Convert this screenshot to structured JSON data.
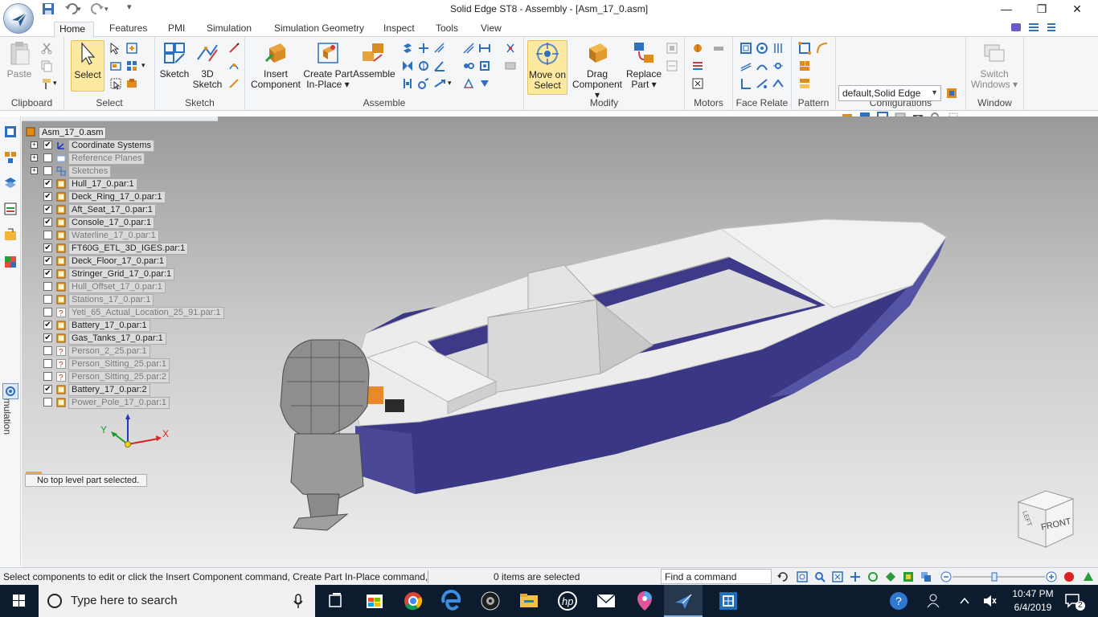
{
  "window": {
    "title": "Solid Edge ST8 - Assembly - [Asm_17_0.asm]",
    "minimize_glyph": "—",
    "maximize_glyph": "❐",
    "close_glyph": "✕"
  },
  "quick_access": {
    "save_icon": "save-icon",
    "undo_icon": "undo-icon",
    "redo_icon": "redo-icon",
    "customize_glyph": "▾"
  },
  "ribbon_tabs": [
    "Home",
    "Features",
    "PMI",
    "Simulation",
    "Simulation Geometry",
    "Inspect",
    "Tools",
    "View"
  ],
  "ribbon": {
    "clipboard": {
      "label": "Clipboard",
      "paste": "Paste"
    },
    "select": {
      "label": "Select",
      "select": "Select"
    },
    "sketch": {
      "label": "Sketch",
      "sketch": "Sketch",
      "sketch3d_line1": "3D",
      "sketch3d_line2": "Sketch"
    },
    "assemble": {
      "label": "Assemble",
      "insert_line1": "Insert",
      "insert_line2": "Component",
      "create_line1": "Create Part",
      "create_line2": "In-Place ▾",
      "assemble": "Assemble"
    },
    "modify": {
      "label": "Modify",
      "move_line1": "Move on",
      "move_line2": "Select",
      "drag_line1": "Drag",
      "drag_line2": "Component ▾",
      "replace_line1": "Replace",
      "replace_line2": "Part ▾"
    },
    "motors": {
      "label": "Motors"
    },
    "face_relate": {
      "label": "Face Relate"
    },
    "pattern": {
      "label": "Pattern"
    },
    "configurations": {
      "label": "Configurations",
      "selected": "default,Solid Edge"
    },
    "window": {
      "label": "Window",
      "switch_line1": "Switch",
      "switch_line2": "Windows ▾"
    }
  },
  "left_rail": {
    "simulation_label": "Simulation"
  },
  "tree": {
    "root": "Asm_17_0.asm",
    "items": [
      {
        "label": "Coordinate Systems",
        "checked": true,
        "expand": "+",
        "dim": false,
        "icon": "coordinate-system-icon"
      },
      {
        "label": "Reference Planes",
        "checked": false,
        "expand": "+",
        "dim": true,
        "icon": "reference-plane-icon"
      },
      {
        "label": "Sketches",
        "checked": false,
        "expand": "+",
        "dim": true,
        "icon": "sketch-icon"
      },
      {
        "label": "Hull_17_0.par:1",
        "checked": true,
        "dim": false,
        "icon": "part-icon"
      },
      {
        "label": "Deck_Ring_17_0.par:1",
        "checked": true,
        "dim": false,
        "icon": "part-icon"
      },
      {
        "label": "Aft_Seat_17_0.par:1",
        "checked": true,
        "dim": false,
        "icon": "part-icon"
      },
      {
        "label": "Console_17_0.par:1",
        "checked": true,
        "dim": false,
        "icon": "part-icon"
      },
      {
        "label": "Waterline_17_0.par:1",
        "checked": false,
        "dim": true,
        "icon": "part-icon"
      },
      {
        "label": "FT60G_ETL_3D_IGES.par:1",
        "checked": true,
        "dim": false,
        "icon": "part-icon"
      },
      {
        "label": "Deck_Floor_17_0.par:1",
        "checked": true,
        "dim": false,
        "icon": "part-icon"
      },
      {
        "label": "Stringer_Grid_17_0.par:1",
        "checked": true,
        "dim": false,
        "icon": "part-icon"
      },
      {
        "label": "Hull_Offset_17_0.par:1",
        "checked": false,
        "dim": true,
        "icon": "part-icon"
      },
      {
        "label": "Stations_17_0.par:1",
        "checked": false,
        "dim": true,
        "icon": "part-icon"
      },
      {
        "label": "Yeti_65_Actual_Location_25_91.par:1",
        "checked": false,
        "dim": true,
        "icon": "missing-part-icon"
      },
      {
        "label": "Battery_17_0.par:1",
        "checked": true,
        "dim": false,
        "icon": "part-icon"
      },
      {
        "label": "Gas_Tanks_17_0.par:1",
        "checked": true,
        "dim": false,
        "icon": "part-icon"
      },
      {
        "label": "Person_2_25.par:1",
        "checked": false,
        "dim": true,
        "icon": "missing-part-icon"
      },
      {
        "label": "Person_Sitting_25.par:1",
        "checked": false,
        "dim": true,
        "icon": "missing-part-icon"
      },
      {
        "label": "Person_Sitting_25.par:2",
        "checked": false,
        "dim": true,
        "icon": "missing-part-icon"
      },
      {
        "label": "Battery_17_0.par:2",
        "checked": true,
        "dim": false,
        "icon": "part-icon"
      },
      {
        "label": "Power_Pole_17_0.par:1",
        "checked": false,
        "dim": true,
        "icon": "part-icon"
      }
    ]
  },
  "viewport": {
    "status_message": "No top level part selected.",
    "triad": {
      "x": "X",
      "y": "Y"
    },
    "viewcube": {
      "front": "FRONT",
      "left": "LEFT"
    },
    "colors": {
      "hull": "#3a3784",
      "deck": "#ececec",
      "motor": "#8b8b8b",
      "accent": "#e8892b"
    }
  },
  "statusbar": {
    "prompt": "Select components to edit or click the Insert Component command, Create Part In-Place command,",
    "items_selected": "0 items are selected",
    "find_command": "Find a command"
  },
  "taskbar": {
    "search_placeholder": "Type here to search",
    "time": "10:47 PM",
    "date": "6/4/2019",
    "notification_count": "2"
  }
}
